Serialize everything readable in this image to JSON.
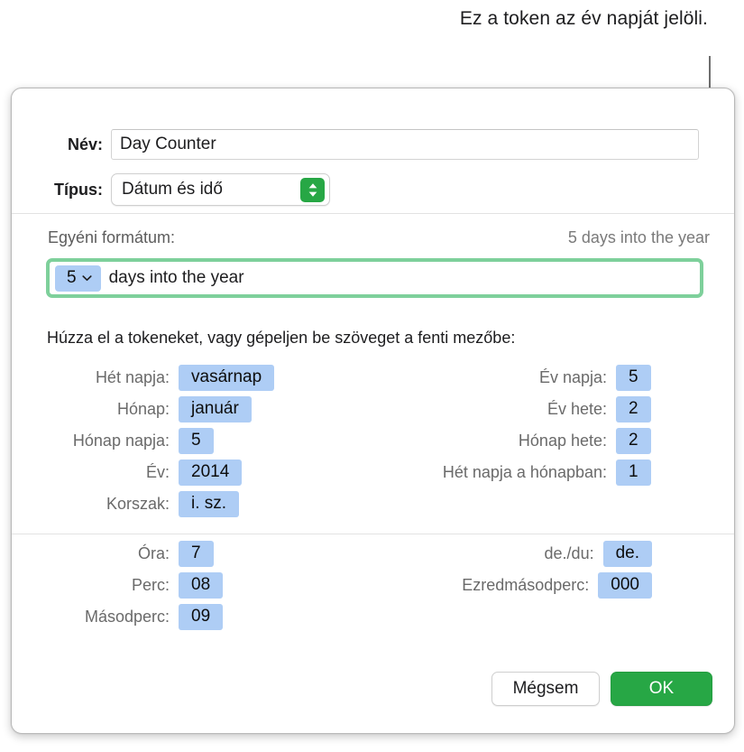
{
  "callout": {
    "text": "Ez a token az év napját jelöli."
  },
  "accent_color": "#27a745",
  "token_color": "#aecdf5",
  "focus_ring_color": "#7ed09b",
  "dialog": {
    "name_row": {
      "label": "Név:",
      "value": "Day Counter",
      "placeholder": ""
    },
    "type_row": {
      "label": "Típus:",
      "value": "Dátum és idő"
    },
    "custom_format": {
      "label": "Egyéni formátum:",
      "preview": "5 days into the year",
      "field_token": "5",
      "field_text": "days into the year"
    },
    "instructions": "Húzza el a tokeneket, vagy gépeljen be szöveget a fenti mezőbe:",
    "date_tokens_left": [
      {
        "label": "Hét napja:",
        "value": "vasárnap"
      },
      {
        "label": "Hónap:",
        "value": "január"
      },
      {
        "label": "Hónap napja:",
        "value": "5"
      },
      {
        "label": "Év:",
        "value": "2014"
      },
      {
        "label": "Korszak:",
        "value": "i. sz."
      }
    ],
    "date_tokens_right": [
      {
        "label": "Év napja:",
        "value": "5"
      },
      {
        "label": "Év hete:",
        "value": "2"
      },
      {
        "label": "Hónap hete:",
        "value": "2"
      },
      {
        "label": "Hét napja a hónapban:",
        "value": "1"
      }
    ],
    "time_tokens_left": [
      {
        "label": "Óra:",
        "value": "7"
      },
      {
        "label": "Perc:",
        "value": "08"
      },
      {
        "label": "Másodperc:",
        "value": "09"
      }
    ],
    "time_tokens_right": [
      {
        "label": "de./du:",
        "value": "de."
      },
      {
        "label": "Ezredmásodperc:",
        "value": "000"
      }
    ],
    "buttons": {
      "cancel": "Mégsem",
      "ok": "OK"
    }
  }
}
